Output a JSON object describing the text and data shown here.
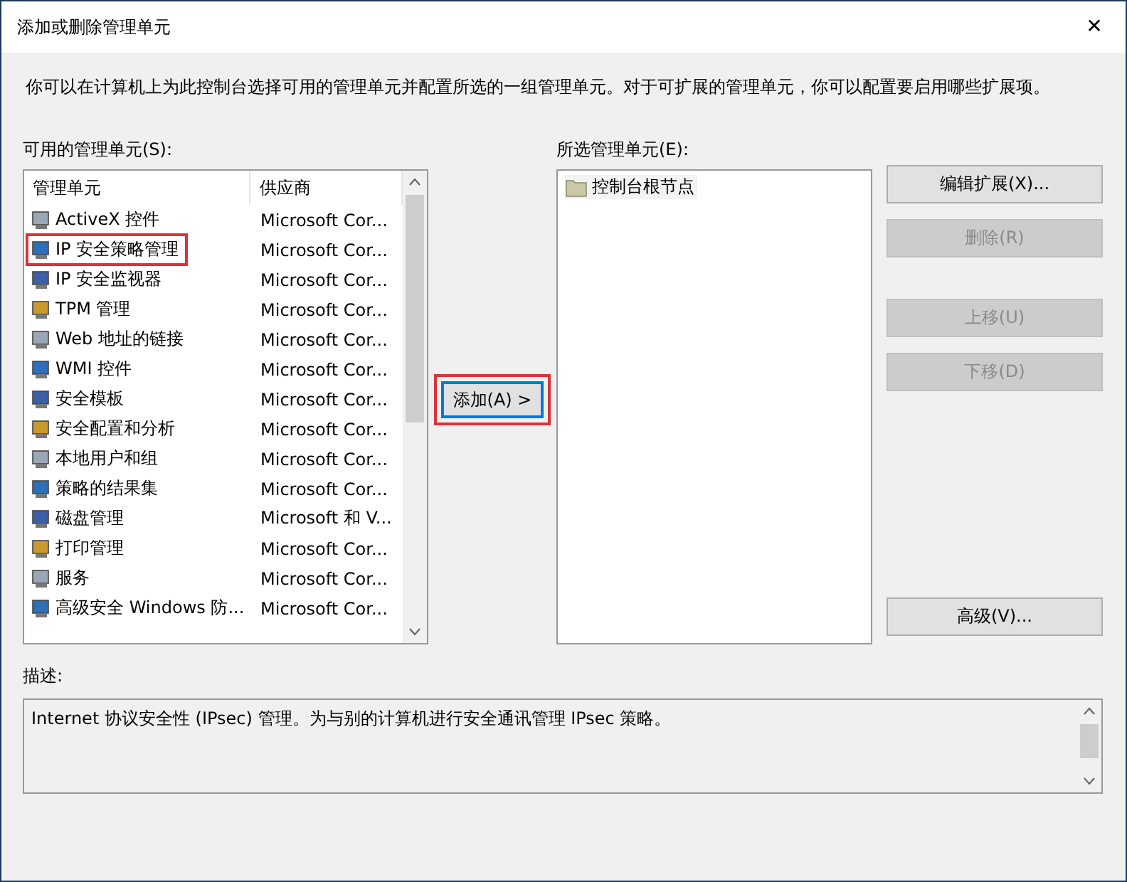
{
  "window": {
    "title": "添加或删除管理单元",
    "close": "✕"
  },
  "intro": "你可以在计算机上为此控制台选择可用的管理单元并配置所选的一组管理单元。对于可扩展的管理单元，你可以配置要启用哪些扩展项。",
  "available": {
    "label": "可用的管理单元(S):",
    "columns": [
      "管理单元",
      "供应商"
    ],
    "rows": [
      {
        "name": "ActiveX 控件",
        "vendor": "Microsoft Cor...",
        "annotated": false
      },
      {
        "name": "IP 安全策略管理",
        "vendor": "Microsoft Cor...",
        "annotated": true
      },
      {
        "name": "IP 安全监视器",
        "vendor": "Microsoft Cor...",
        "annotated": false
      },
      {
        "name": "TPM 管理",
        "vendor": "Microsoft Cor...",
        "annotated": false
      },
      {
        "name": "Web 地址的链接",
        "vendor": "Microsoft Cor...",
        "annotated": false
      },
      {
        "name": "WMI 控件",
        "vendor": "Microsoft Cor...",
        "annotated": false
      },
      {
        "name": "安全模板",
        "vendor": "Microsoft Cor...",
        "annotated": false
      },
      {
        "name": "安全配置和分析",
        "vendor": "Microsoft Cor...",
        "annotated": false
      },
      {
        "name": "本地用户和组",
        "vendor": "Microsoft Cor...",
        "annotated": false
      },
      {
        "name": "策略的结果集",
        "vendor": "Microsoft Cor...",
        "annotated": false
      },
      {
        "name": "磁盘管理",
        "vendor": "Microsoft 和 V...",
        "annotated": false
      },
      {
        "name": "打印管理",
        "vendor": "Microsoft Cor...",
        "annotated": false
      },
      {
        "name": "服务",
        "vendor": "Microsoft Cor...",
        "annotated": false
      },
      {
        "name": "高级安全 Windows 防...",
        "vendor": "Microsoft Cor...",
        "annotated": false
      }
    ]
  },
  "add_button": {
    "label": "添加(A) >",
    "focused": true,
    "annotated": true
  },
  "selected": {
    "label": "所选管理单元(E):",
    "items": [
      "控制台根节点"
    ]
  },
  "buttons": [
    {
      "label": "编辑扩展(X)...",
      "disabled": false
    },
    {
      "label": "删除(R)",
      "disabled": true
    },
    {
      "label": "上移(U)",
      "disabled": true
    },
    {
      "label": "下移(D)",
      "disabled": true
    },
    {
      "label": "高级(V)...",
      "disabled": false
    }
  ],
  "description": {
    "label": "描述:",
    "text": "Internet 协议安全性 (IPsec) 管理。为与别的计算机进行安全通讯管理 IPsec 策略。"
  }
}
